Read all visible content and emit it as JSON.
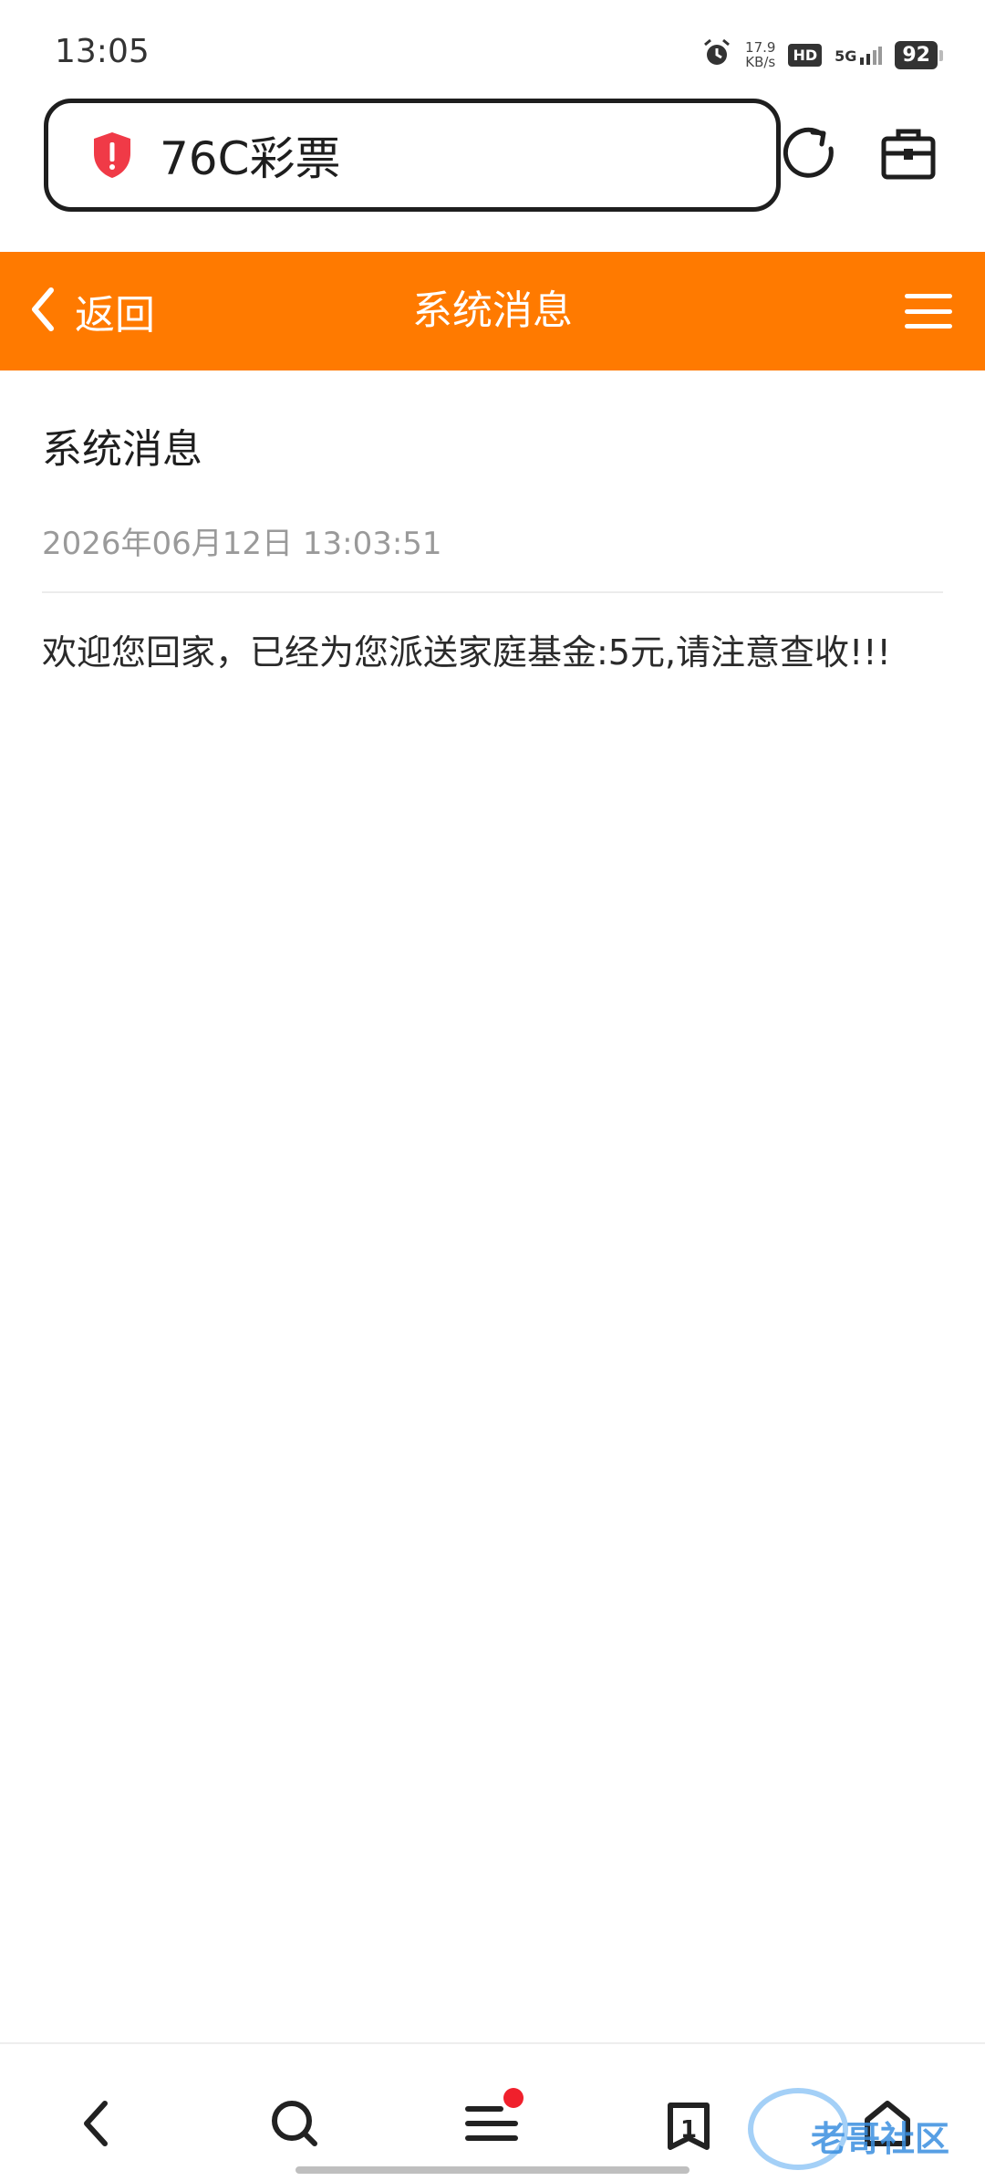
{
  "status_bar": {
    "time": "13:05",
    "net_speed_value": "17.9",
    "net_speed_unit": "KB/s",
    "hd_label": "HD",
    "network": "5G",
    "battery": "92",
    "alarm_icon": "alarm-icon"
  },
  "address_bar": {
    "site_title": "76C彩票",
    "security_icon": "shield-alert-icon",
    "refresh_icon": "refresh-icon",
    "toolbox_icon": "toolbox-icon"
  },
  "header": {
    "back_label": "返回",
    "title": "系统消息",
    "menu_icon": "hamburger-menu-icon",
    "color": "#ff7a00"
  },
  "message": {
    "title": "系统消息",
    "time": "2026年06月12日 13:03:51",
    "body": "欢迎您回家，已经为您派送家庭基金:5元,请注意查收!!!"
  },
  "bottom_nav": {
    "tab_count": "1",
    "items": [
      "back-icon",
      "search-icon",
      "menu-icon",
      "tabs-icon",
      "home-icon"
    ]
  },
  "watermark": {
    "text": "老哥社区"
  }
}
